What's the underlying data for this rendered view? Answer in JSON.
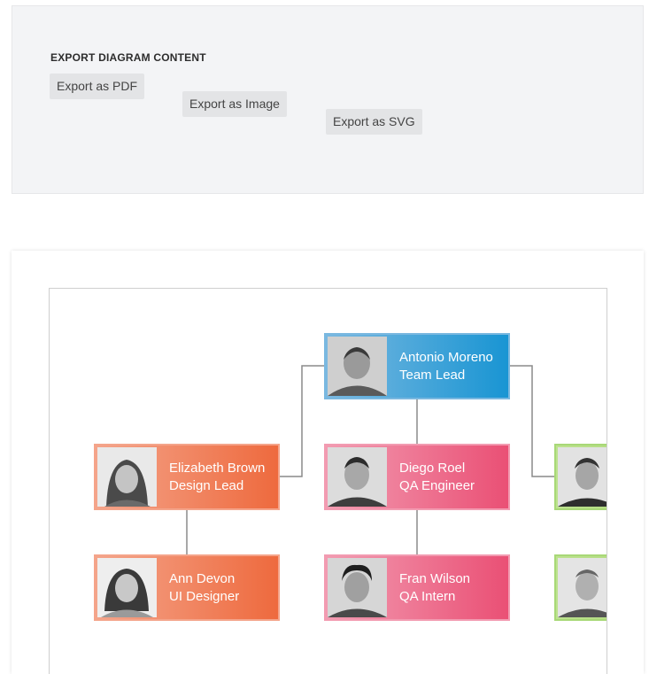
{
  "export": {
    "title": "EXPORT DIAGRAM CONTENT",
    "buttons": [
      "Export as PDF",
      "Export as Image",
      "Export as SVG"
    ]
  },
  "diagram": {
    "nodes": [
      {
        "id": "antonio",
        "name": "Antonio Moreno",
        "title": "Team Lead",
        "gradient": [
          "#7ab8e0",
          "#1995d3"
        ],
        "border": "#7ab8e0"
      },
      {
        "id": "elizabeth",
        "name": "Elizabeth Brown",
        "title": "Design Lead",
        "gradient": [
          "#f4a48a",
          "#ee6a3e"
        ],
        "border": "#f4a48a"
      },
      {
        "id": "diego",
        "name": "Diego Roel",
        "title": "QA Engineer",
        "gradient": [
          "#f29bb1",
          "#ea5075"
        ],
        "border": "#f29bb1"
      },
      {
        "id": "ann",
        "name": "Ann Devon",
        "title": "UI Designer",
        "gradient": [
          "#f4a48a",
          "#ee6a3e"
        ],
        "border": "#f4a48a"
      },
      {
        "id": "fran",
        "name": "Fran Wilson",
        "title": "QA Intern",
        "gradient": [
          "#f29bb1",
          "#ea5075"
        ],
        "border": "#f29bb1"
      },
      {
        "id": "green1",
        "name": "",
        "title": "",
        "gradient": [
          "#bde28f",
          "#9fd069"
        ],
        "border": "#a8d877"
      },
      {
        "id": "green2",
        "name": "",
        "title": "",
        "gradient": [
          "#bde28f",
          "#9fd069"
        ],
        "border": "#a8d877"
      }
    ],
    "connector_color": "#8a8a8a"
  }
}
